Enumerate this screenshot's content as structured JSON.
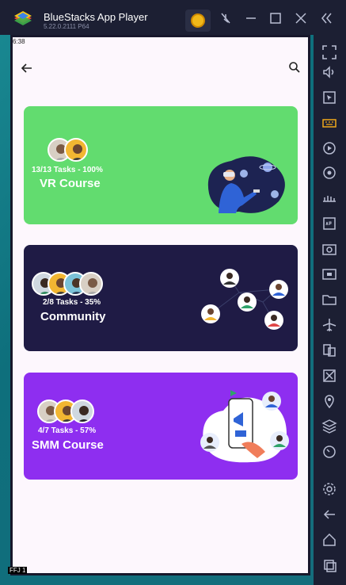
{
  "window": {
    "app_title": "BlueStacks App Player",
    "version": "5.22.0.2111  P64"
  },
  "status_bar": {
    "time": "6:38"
  },
  "cards": [
    {
      "tasks": "13/13 Tasks - 100%",
      "title": "VR Course",
      "color": "#62dc6f"
    },
    {
      "tasks": "2/8 Tasks - 35%",
      "title": "Community",
      "color": "#1f1b45"
    },
    {
      "tasks": "4/7 Tasks - 57%",
      "title": "SMM Course",
      "color": "#8e2ef0"
    }
  ],
  "bottom_indicator": "FFJ  1",
  "icons": {
    "back": "back-arrow-icon",
    "search": "search-icon"
  }
}
